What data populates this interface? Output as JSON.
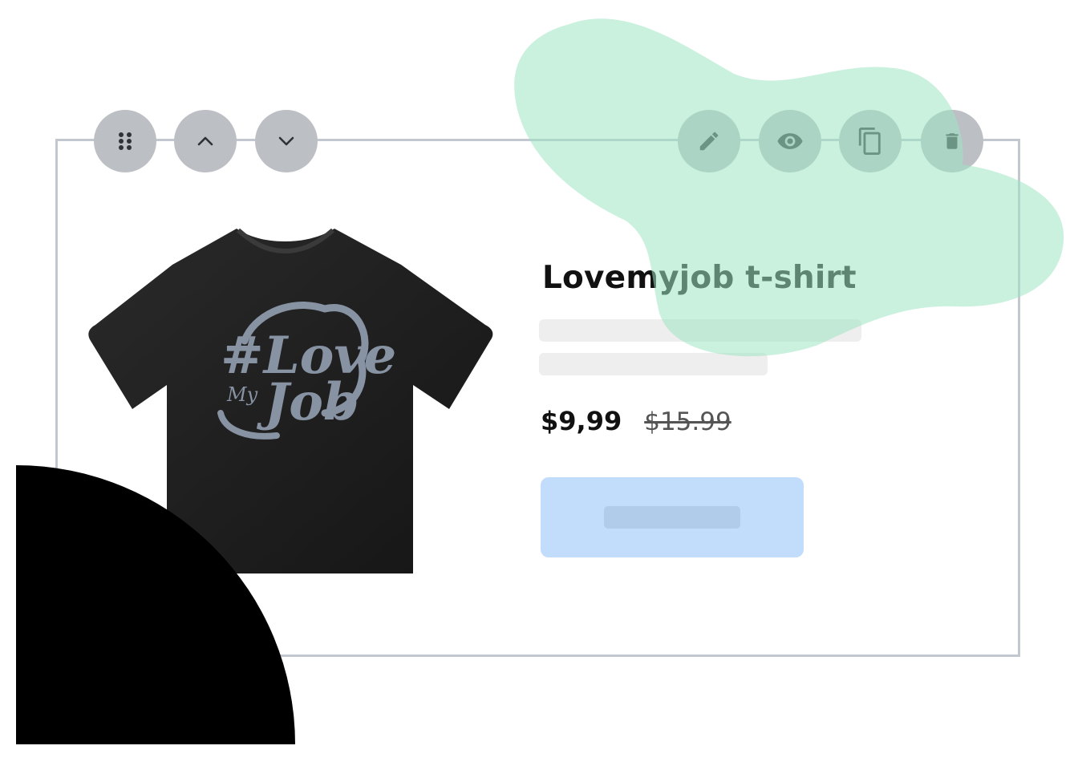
{
  "product": {
    "title": "Lovemyjob t-shirt",
    "price_current": "$9,99",
    "price_old": "$15.99",
    "image": {
      "icon": "tshirt-image",
      "print_text_top": "#Love",
      "print_text_middle": "My",
      "print_text_bottom": "Job"
    }
  },
  "toolbar": {
    "left_icons": [
      "drag-handle-icon",
      "chevron-up-icon",
      "chevron-down-icon"
    ],
    "right_icons": [
      "pencil-icon",
      "eye-icon",
      "copy-icon",
      "trash-icon"
    ]
  },
  "colors": {
    "toolbar_button": "#bcc0c5",
    "frame_border": "#c3c8d0",
    "blob": "#bfeed8",
    "cta_background": "#c2ddfb",
    "skeleton": "#eeeeee",
    "corner_shape": "#000000"
  }
}
